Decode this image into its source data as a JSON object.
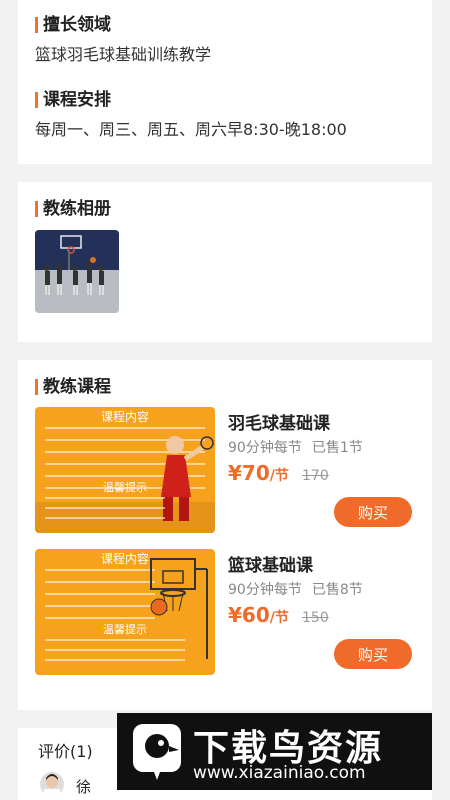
{
  "specialty": {
    "title": "擅长领域",
    "text": "篮球羽毛球基础训练教学"
  },
  "schedule": {
    "title": "课程安排",
    "text": "每周一、周三、周五、周六早8:30-晚18:00"
  },
  "album": {
    "title": "教练相册",
    "photos": [
      {
        "icon": "basketball-court-photo"
      }
    ]
  },
  "courses": {
    "title": "教练课程",
    "items": [
      {
        "name": "羽毛球基础课",
        "duration": "90分钟每节",
        "sold": "已售1节",
        "currency": "¥",
        "price": "70",
        "unit": "/节",
        "original": "170",
        "buy_label": "购买",
        "poster_heading": "课程内容",
        "poster_tip": "温馨提示"
      },
      {
        "name": "篮球基础课",
        "duration": "90分钟每节",
        "sold": "已售8节",
        "currency": "¥",
        "price": "60",
        "unit": "/节",
        "original": "150",
        "buy_label": "购买",
        "poster_heading": "课程内容",
        "poster_tip": "温馨提示"
      }
    ]
  },
  "reviews": {
    "title": "评价(1)",
    "first_reviewer": "徐"
  },
  "watermark": {
    "title": "下载鸟资源",
    "url": "www.xiazainiao.com"
  },
  "colors": {
    "accent": "#f06a2a",
    "poster": "#f6a21c",
    "background": "#f2f2f2"
  }
}
